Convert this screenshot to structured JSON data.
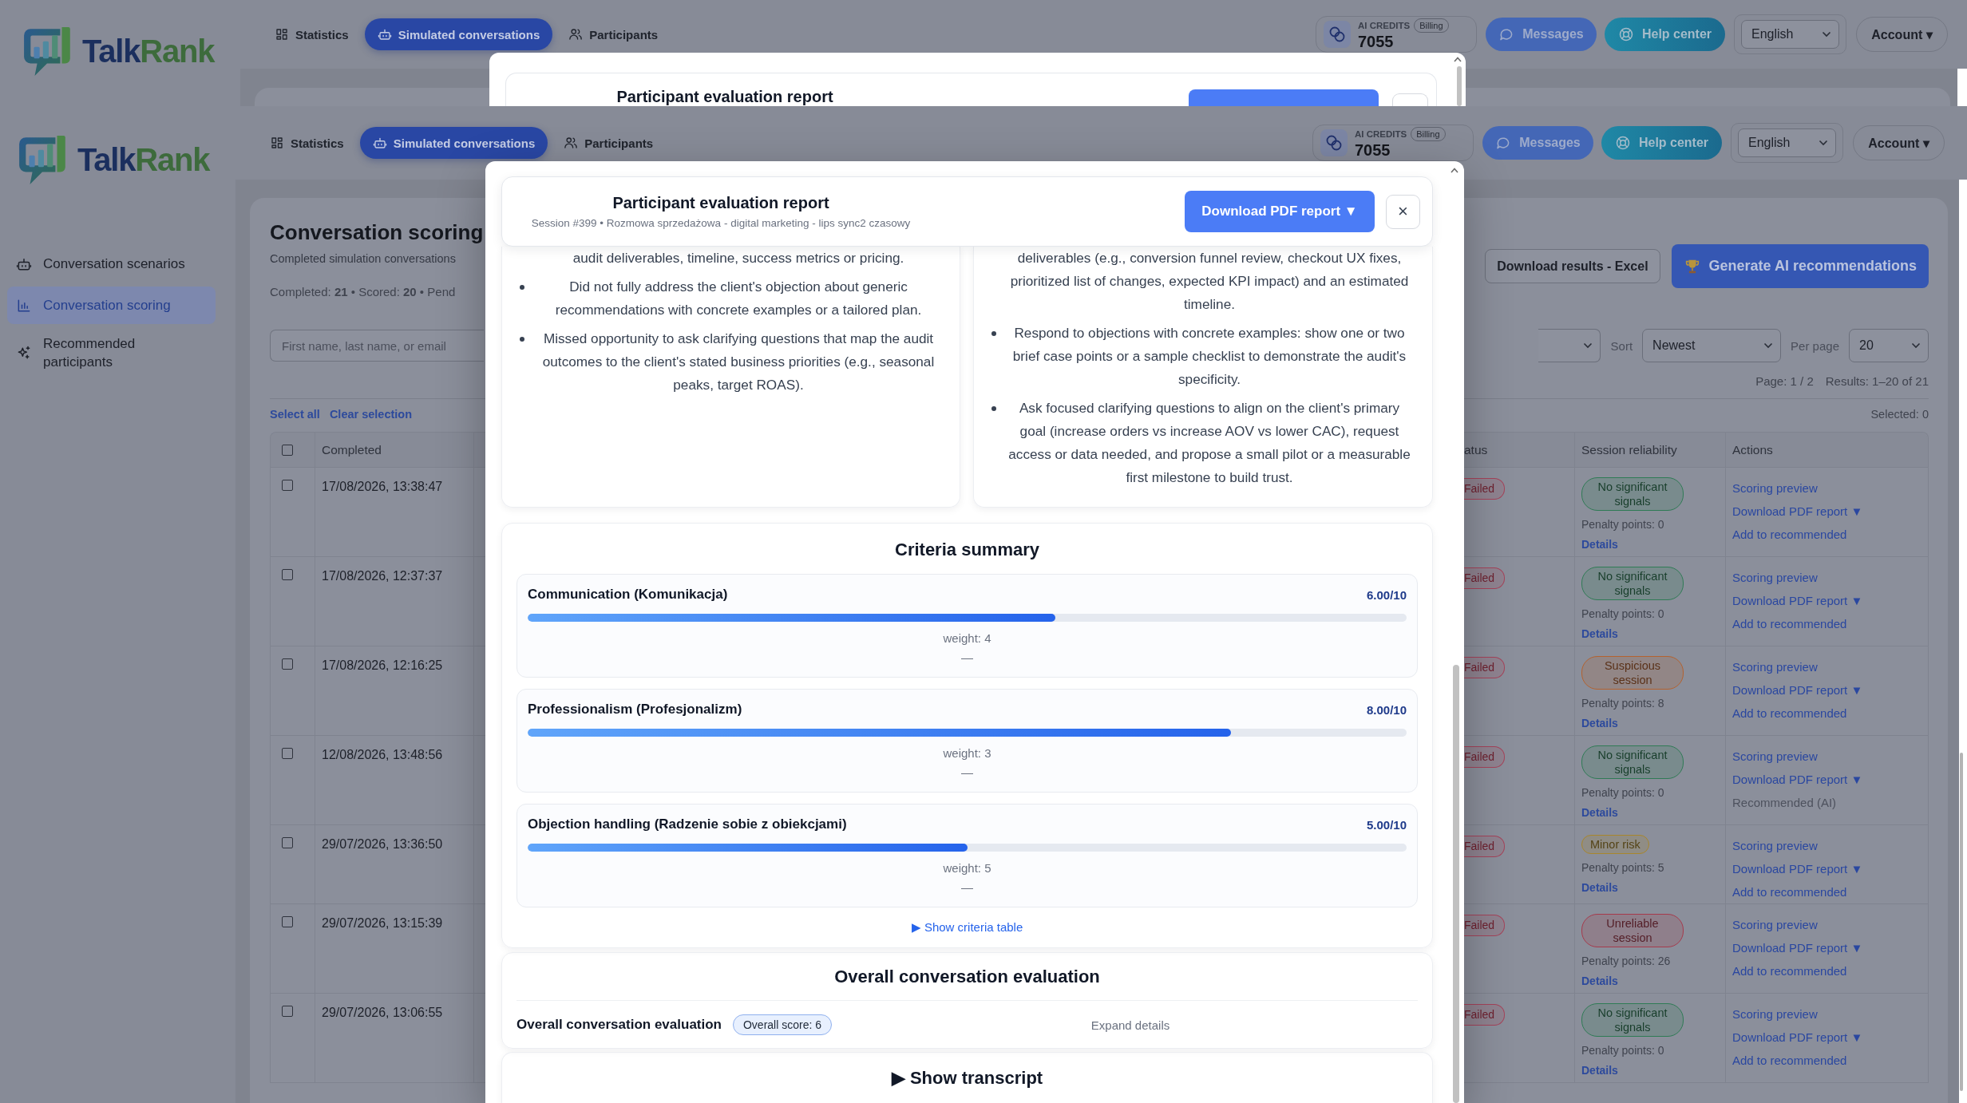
{
  "background_page": {
    "header": {
      "logo": [
        "Talk",
        "Rank"
      ],
      "nav": [
        {
          "label": "Statistics",
          "selected": false
        },
        {
          "label": "Simulated conversations",
          "selected": true
        },
        {
          "label": "Participants",
          "selected": false
        }
      ],
      "credits": {
        "label": "AI CREDITS",
        "billing": "Billing",
        "value": "7055"
      },
      "messages": "Messages",
      "help": "Help center",
      "language": "English",
      "account": "Account ▾"
    },
    "report_dialog": {
      "title": "Participant evaluation report"
    }
  },
  "page": {
    "header": {
      "logo": [
        "Talk",
        "Rank"
      ],
      "nav": [
        {
          "label": "Statistics",
          "selected": false
        },
        {
          "label": "Simulated conversations",
          "selected": true
        },
        {
          "label": "Participants",
          "selected": false
        }
      ],
      "credits": {
        "label": "AI CREDITS",
        "billing": "Billing",
        "value": "7055"
      },
      "messages": "Messages",
      "help": "Help center",
      "language": "English",
      "account": "Account ▾"
    },
    "sidebar": {
      "items": [
        {
          "label": "Conversation scenarios",
          "selected": false
        },
        {
          "label": "Conversation scoring",
          "selected": true
        },
        {
          "label": "Recommended participants",
          "selected": false
        }
      ]
    },
    "scoring": {
      "title": "Conversation scoring",
      "subtitle": "Completed simulation conversations",
      "counts": "Completed: **21** • Scored: **20** • Pend",
      "export_button": "Download results - Excel",
      "ai_button": "Generate AI recommendations",
      "search": {
        "placeholder": "First name, last name, or email"
      },
      "sort": {
        "label": "Sort",
        "value": "Newest"
      },
      "per_page": {
        "label": "Per page",
        "value": "20"
      },
      "pagination": {
        "page": "Page: 1 / 2",
        "results": "Results: 1–20 of 21"
      },
      "select_all": "Select all",
      "clear_selection": "Clear selection",
      "selected_count": "Selected: 0",
      "table": {
        "header_checked": false,
        "columns": [
          "Completed",
          "atus",
          "Session reliability",
          "Actions"
        ],
        "rows": [
          {
            "checked": false,
            "completed": "17/08/2026, 13:38:47",
            "status": "Failed",
            "reliability": {
              "label": "No significant signals",
              "color": "#2f7b55"
            },
            "penalty": "Penalty points: 0",
            "details": "Details",
            "actions": [
              "Scoring preview",
              "Download PDF report ▼"
            ],
            "recommend": {
              "label": "Add to recommended",
              "kind": "link"
            }
          },
          {
            "checked": false,
            "completed": "17/08/2026, 12:37:37",
            "status": "Failed",
            "reliability": {
              "label": "No significant signals",
              "color": "#2f7b55"
            },
            "penalty": "Penalty points: 0",
            "details": "Details",
            "actions": [
              "Scoring preview",
              "Download PDF report ▼"
            ],
            "recommend": {
              "label": "Add to recommended",
              "kind": "link"
            }
          },
          {
            "checked": false,
            "completed": "17/08/2026, 12:16:25",
            "status": "Failed",
            "reliability": {
              "label": "Suspicious session",
              "color": "#b4622f"
            },
            "penalty": "Penalty points: 8",
            "details": "Details",
            "actions": [
              "Scoring preview",
              "Download PDF report ▼"
            ],
            "recommend": {
              "label": "Add to recommended",
              "kind": "link"
            }
          },
          {
            "checked": false,
            "completed": "12/08/2026, 13:48:56",
            "status": "Failed",
            "reliability": {
              "label": "No significant signals",
              "color": "#2f7b55"
            },
            "penalty": "Penalty points: 0",
            "details": "Details",
            "actions": [
              "Scoring preview",
              "Download PDF report ▼"
            ],
            "recommend": {
              "label": "Recommended (AI)",
              "kind": "note"
            }
          },
          {
            "checked": false,
            "completed": "29/07/2026, 13:36:50",
            "status": "Failed",
            "reliability": {
              "label": "Minor risk",
              "color": "#a8862c"
            },
            "penalty": "Penalty points: 5",
            "details": "Details",
            "actions": [
              "Scoring preview",
              "Download PDF report ▼"
            ],
            "recommend": {
              "label": "Add to recommended",
              "kind": "link"
            }
          },
          {
            "checked": false,
            "completed": "29/07/2026, 13:15:39",
            "status": "Failed",
            "reliability": {
              "label": "Unreliable session",
              "color": "#a63a4c"
            },
            "penalty": "Penalty points: 26",
            "details": "Details",
            "actions": [
              "Scoring preview",
              "Download PDF report ▼"
            ],
            "recommend": {
              "label": "Add to recommended",
              "kind": "link"
            }
          },
          {
            "checked": false,
            "completed": "29/07/2026, 13:06:55",
            "status": "Failed",
            "reliability": {
              "label": "No significant signals",
              "color": "#2f7b55"
            },
            "penalty": "Penalty points: 0",
            "details": "Details",
            "actions": [
              "Scoring preview",
              "Download PDF report ▼"
            ],
            "recommend": {
              "label": "Add to recommended",
              "kind": "link"
            }
          }
        ]
      }
    },
    "report_dialog": {
      "title": "Participant evaluation report",
      "subtitle": "Session #399 • Rozmowa sprzedażowa - digital marketing - lips sync2 czasowy",
      "download": "Download PDF report ▼",
      "close": "×",
      "feedback": [
        {
          "continued": "audit deliverables, timeline, success metrics or pricing.",
          "points": [
            "Did not fully address the client's objection about generic recommendations with concrete examples or a tailored plan.",
            "Missed opportunity to ask clarifying questions that map the audit outcomes to the client's stated business priorities (e.g., seasonal peaks, target ROAS)."
          ]
        },
        {
          "continued": "deliverables (e.g., conversion funnel review, checkout UX fixes, prioritized list of changes, expected KPI impact) and an estimated timeline.",
          "points": [
            "Respond to objections with concrete examples: show one or two brief case points or a sample checklist to demonstrate the audit's specificity.",
            "Ask focused clarifying questions to align on the client's primary goal (increase orders vs increase AOV vs lower CAC), request access or data needed, and propose a small pilot or a measurable first milestone to build trust."
          ]
        }
      ],
      "criteria_summary": {
        "title": "Criteria summary",
        "criteria": [
          {
            "name": "Communication (Komunikacja)",
            "score": "6.00/10",
            "level": 0.6,
            "weight": "weight: 4",
            "note": "—"
          },
          {
            "name": "Professionalism (Profesjonalizm)",
            "score": "8.00/10",
            "level": 0.8,
            "weight": "weight: 3",
            "note": "—"
          },
          {
            "name": "Objection handling (Radzenie sobie z obiekcjami)",
            "score": "5.00/10",
            "level": 0.5,
            "weight": "weight: 5",
            "note": "—"
          }
        ],
        "toggle": "▶ Show criteria table"
      },
      "overall": {
        "title": "Overall conversation evaluation",
        "label": "Overall conversation evaluation",
        "score": "Overall score: 6",
        "expand": "Expand details"
      },
      "transcript": {
        "toggle": "▶ Show transcript"
      }
    }
  }
}
